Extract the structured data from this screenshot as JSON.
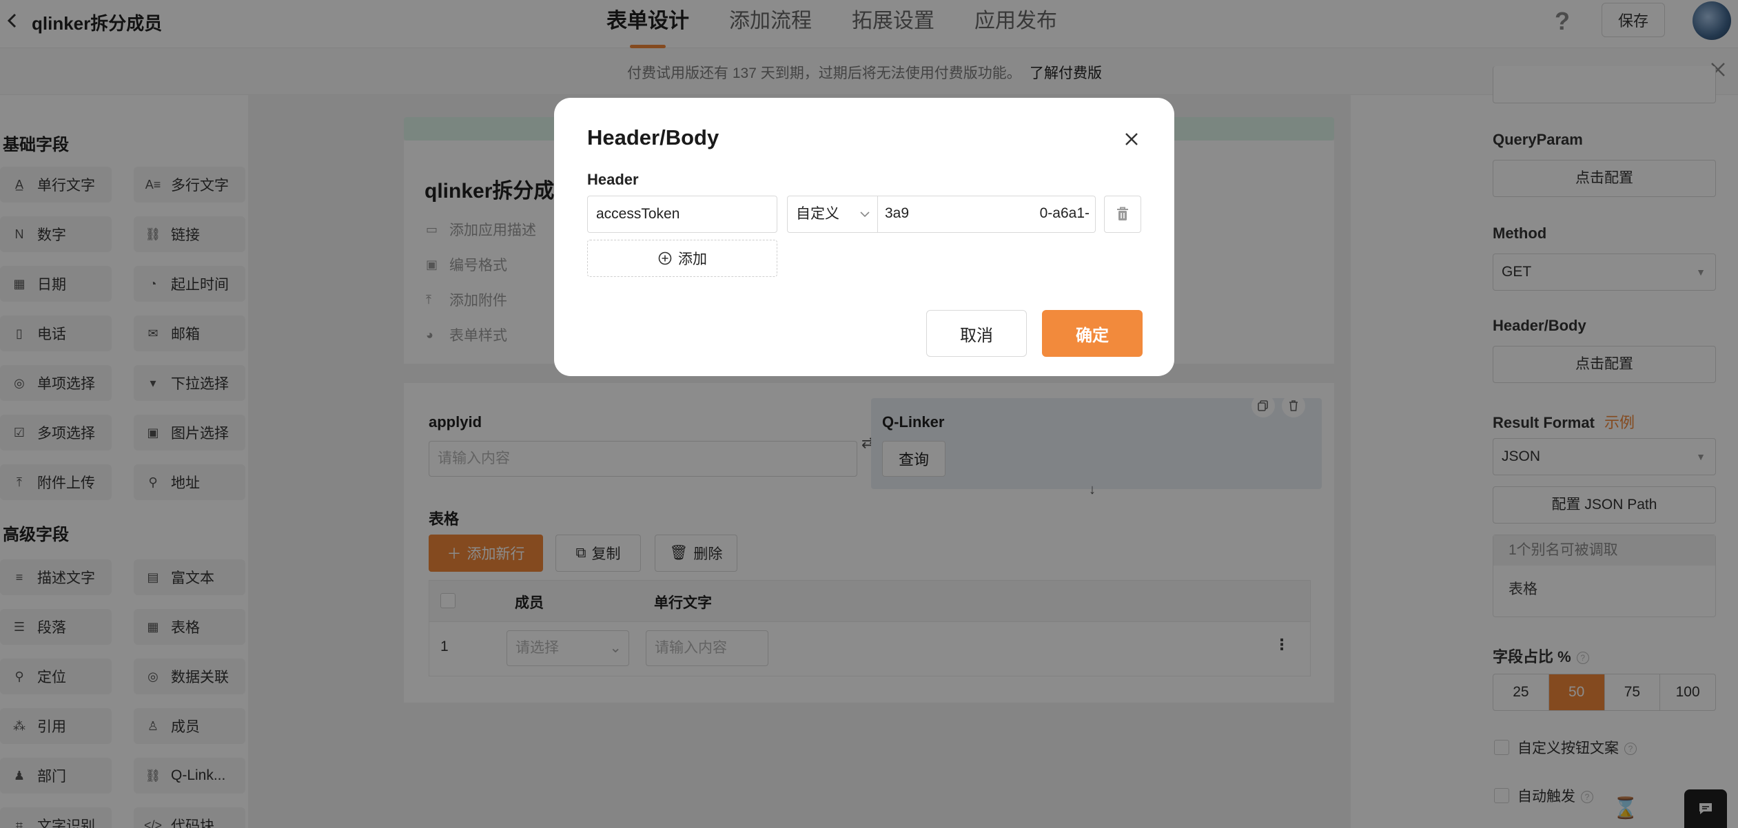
{
  "header": {
    "app_title": "qlinker拆分成员",
    "tabs": [
      "表单设计",
      "添加流程",
      "拓展设置",
      "应用发布"
    ],
    "active_tab": 0,
    "help": "?",
    "save_label": "保存"
  },
  "banner": {
    "text": "付费试用版还有 137 天到期，过期后将无法使用付费版功能。",
    "link": "了解付费版"
  },
  "left_panel": {
    "basic_title": "基础字段",
    "basic_fields": [
      {
        "label": "单行文字",
        "icon": "A̲"
      },
      {
        "label": "多行文字",
        "icon": "A≡"
      },
      {
        "label": "数字",
        "icon": "N"
      },
      {
        "label": "链接",
        "icon": "⛓"
      },
      {
        "label": "日期",
        "icon": "▦"
      },
      {
        "label": "起止时间",
        "icon": "◔"
      },
      {
        "label": "电话",
        "icon": "▯"
      },
      {
        "label": "邮箱",
        "icon": "✉"
      },
      {
        "label": "单项选择",
        "icon": "◎"
      },
      {
        "label": "下拉选择",
        "icon": "▾"
      },
      {
        "label": "多项选择",
        "icon": "☑"
      },
      {
        "label": "图片选择",
        "icon": "▣"
      },
      {
        "label": "附件上传",
        "icon": "⤒"
      },
      {
        "label": "地址",
        "icon": "⚲"
      }
    ],
    "advanced_title": "高级字段",
    "advanced_fields": [
      {
        "label": "描述文字",
        "icon": "≡"
      },
      {
        "label": "富文本",
        "icon": "▤"
      },
      {
        "label": "段落",
        "icon": "☰"
      },
      {
        "label": "表格",
        "icon": "▦"
      },
      {
        "label": "定位",
        "icon": "⚲"
      },
      {
        "label": "数据关联",
        "icon": "◎"
      },
      {
        "label": "引用",
        "icon": "⁂"
      },
      {
        "label": "成员",
        "icon": "♙"
      },
      {
        "label": "部门",
        "icon": "♟"
      },
      {
        "label": "Q-Link...",
        "icon": "⛓"
      },
      {
        "label": "文字识别",
        "icon": "⌗"
      },
      {
        "label": "代码块",
        "icon": "</>"
      }
    ]
  },
  "canvas": {
    "form_title": "qlinker拆分成",
    "form_options": [
      "添加应用描述",
      "编号格式",
      "添加附件",
      "表单样式"
    ],
    "applyid_label": "applyid",
    "applyid_placeholder": "请输入内容",
    "qlinker_label": "Q-Linker",
    "query_button": "查询",
    "table_label": "表格",
    "add_row": "添加新行",
    "copy": "复制",
    "delete": "删除",
    "columns": [
      "成员",
      "单行文字"
    ],
    "rows": [
      {
        "index": "1",
        "member_placeholder": "请选择",
        "text_placeholder": "请输入内容"
      }
    ]
  },
  "right_panel": {
    "queryparam_label": "QueryParam",
    "configure": "点击配置",
    "method_label": "Method",
    "method_value": "GET",
    "headerbody_label": "Header/Body",
    "result_format_label": "Result Format",
    "example_link": "示例",
    "result_format_value": "JSON",
    "json_path_button": "配置 JSON Path",
    "alias_header": "1个别名可被调取",
    "alias_item": "表格",
    "field_ratio_label": "字段占比 %",
    "ratios": [
      "25",
      "50",
      "75",
      "100"
    ],
    "ratio_selected": 1,
    "custom_button_text": "自定义按钮文案",
    "auto_trigger": "自动触发"
  },
  "modal": {
    "title": "Header/Body",
    "header_label": "Header",
    "rows": [
      {
        "key": "accessToken",
        "type": "自定义",
        "value_start": "3a9",
        "value_end": "0-a6a1-"
      }
    ],
    "add_label": "添加",
    "cancel": "取消",
    "confirm": "确定"
  },
  "colors": {
    "accent": "#f0883a",
    "overlay": "rgba(0,0,0,0.45)",
    "qlinker_bg": "#e9eef5"
  }
}
